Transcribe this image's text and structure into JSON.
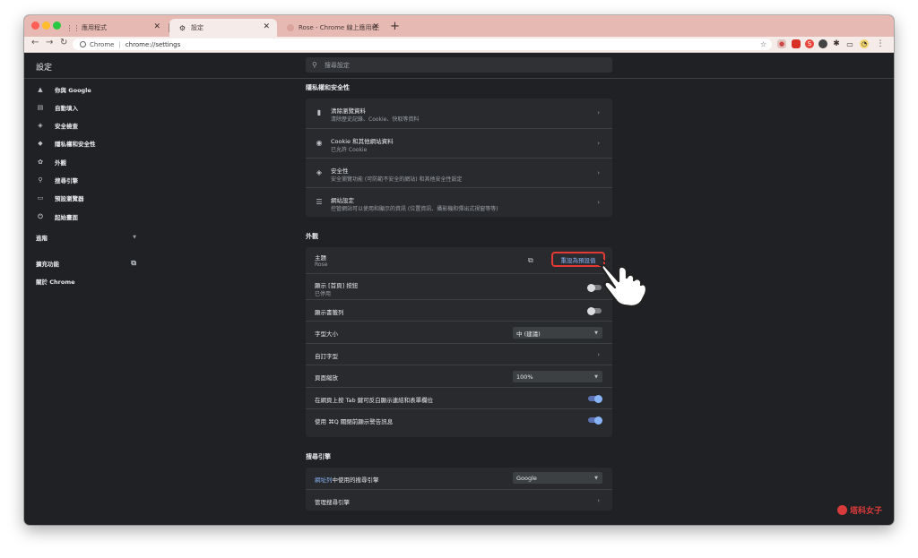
{
  "tabs": [
    {
      "label": "應用程式",
      "icon": "apps-icon",
      "active": false
    },
    {
      "label": "設定",
      "icon": "gear-icon",
      "active": true
    },
    {
      "label": "Rose - Chrome 線上應用程式商",
      "icon": "rose-theme-icon",
      "active": false
    }
  ],
  "toolbar": {
    "scheme": "Chrome",
    "url": "chrome://settings"
  },
  "sidebar": {
    "title": "設定",
    "items": [
      {
        "label": "你與 Google",
        "icon": "person-icon"
      },
      {
        "label": "自動填入",
        "icon": "clipboard-icon"
      },
      {
        "label": "安全檢查",
        "icon": "shield-check-icon"
      },
      {
        "label": "隱私權和安全性",
        "icon": "shield-icon"
      },
      {
        "label": "外觀",
        "icon": "palette-icon"
      },
      {
        "label": "搜尋引擎",
        "icon": "search-icon"
      },
      {
        "label": "預設瀏覽器",
        "icon": "browser-icon"
      },
      {
        "label": "起始畫面",
        "icon": "power-icon"
      }
    ],
    "advanced": "進階",
    "extensions": "擴充功能",
    "about": "關於 Chrome"
  },
  "search": {
    "placeholder": "搜尋設定"
  },
  "privacy": {
    "header": "隱私權和安全性",
    "rows": [
      {
        "title": "清除瀏覽資料",
        "sub": "清除歷史記錄、Cookie、快取等資料",
        "icon": "trash-icon"
      },
      {
        "title": "Cookie 和其他網站資料",
        "sub": "已允許 Cookie",
        "icon": "cookie-icon"
      },
      {
        "title": "安全性",
        "sub": "安全瀏覽功能 (可防範不安全的網站) 和其他安全性設定",
        "icon": "security-shield-icon"
      },
      {
        "title": "網站設定",
        "sub": "控管網站可以使用和顯示的資訊 (位置資訊、攝影機和彈出式視窗等等)",
        "icon": "sliders-icon"
      }
    ]
  },
  "appearance": {
    "header": "外觀",
    "theme_title": "主題",
    "theme_value": "Rose",
    "reset_label": "重設為預設值",
    "home_title": "顯示 [首頁] 按鈕",
    "home_sub": "已停用",
    "home_on": false,
    "bookmarks_title": "顯示書籤列",
    "bookmarks_on": false,
    "font_size_title": "字型大小",
    "font_size_value": "中 (建議)",
    "custom_font_title": "自訂字型",
    "zoom_title": "頁面縮放",
    "zoom_value": "100%",
    "tab_highlight_title": "在網頁上按 Tab 鍵可反白顯示連結和表單欄位",
    "tab_highlight_on": true,
    "quit_warn_title": "使用 ⌘Q 關閉前顯示警告訊息",
    "quit_warn_on": true
  },
  "search_engine": {
    "header": "搜尋引擎",
    "row1_link": "網址列",
    "row1_rest": "中使用的搜尋引擎",
    "engine_value": "Google",
    "manage_title": "管理搜尋引擎"
  },
  "watermark": "塔科女子",
  "colors": {
    "accent": "#8ab4f8",
    "highlight": "#e53935",
    "tabstrip": "#e6b9b3"
  }
}
